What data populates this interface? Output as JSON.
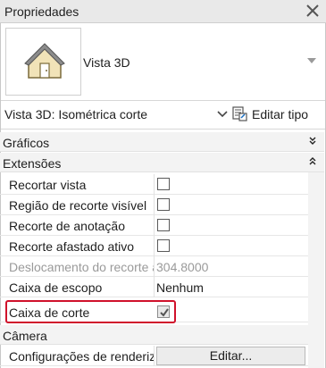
{
  "panel": {
    "title": "Propriedades",
    "close_icon": "close-icon"
  },
  "type_selector": {
    "type_name": "Vista 3D",
    "thumbnail_icon": "house-3d-icon"
  },
  "view_row": {
    "current_view": "Vista 3D: Isométrica corte",
    "edit_type_label": "Editar tipo"
  },
  "groups": {
    "graficos": {
      "label": "Gráficos",
      "state": "collapsed"
    },
    "extensoes": {
      "label": "Extensões",
      "state": "expanded"
    },
    "camera": {
      "label": "Câmera",
      "state": "expanded"
    }
  },
  "extensoes_rows": [
    {
      "name": "Recortar vista",
      "type": "checkbox",
      "checked": false
    },
    {
      "name": "Região de recorte visível",
      "type": "checkbox",
      "checked": false
    },
    {
      "name": "Recorte de anotação",
      "type": "checkbox",
      "checked": false
    },
    {
      "name": "Recorte afastado ativo",
      "type": "checkbox",
      "checked": false
    },
    {
      "name": "Deslocamento do recorte afastado",
      "type": "text",
      "value": "304.8000",
      "disabled": true
    },
    {
      "name": "Caixa de escopo",
      "type": "text",
      "value": "Nenhum"
    },
    {
      "name": "Caixa de corte",
      "type": "checkbox",
      "checked": true,
      "highlighted": true
    }
  ],
  "camera_rows": [
    {
      "name": "Configurações de renderização",
      "type": "button",
      "button_label": "Editar..."
    }
  ],
  "colors": {
    "highlight_border": "#d0112b",
    "group_background": "#f3f3f3",
    "disabled_text": "#9a9a9a"
  }
}
